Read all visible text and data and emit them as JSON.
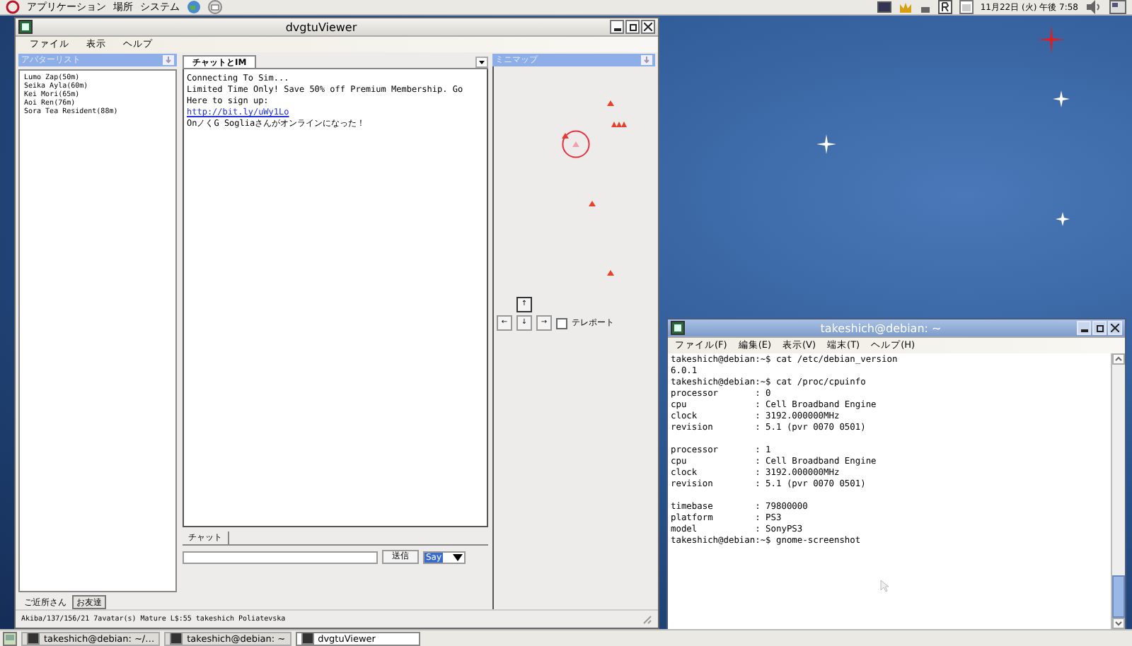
{
  "top_panel": {
    "menus": [
      "アプリケーション",
      "場所",
      "システム"
    ],
    "clock": "11月22日 (火) 午後 7:58"
  },
  "viewer": {
    "title": "dvgtuViewer",
    "menus": [
      "ファイル",
      "表示",
      "ヘルプ"
    ],
    "avatar_list": {
      "title": "アバターリスト",
      "items": [
        "Lumo Zap(50m)",
        "Seika Ayla(60m)",
        "Kei Mori(65m)",
        "Aoi Ren(76m)",
        "Sora Tea Resident(88m)"
      ],
      "tabs": [
        {
          "label": "ご近所さん",
          "selected": true
        },
        {
          "label": "お友達",
          "selected": false
        }
      ]
    },
    "chat": {
      "tabs": [
        {
          "label": "チャットとIM",
          "selected": true
        }
      ],
      "lines": [
        {
          "kind": "text",
          "text": "Connecting To Sim..."
        },
        {
          "kind": "text",
          "text": "Limited Time Only! Save 50% off Premium Membership. Go Here to sign up:"
        },
        {
          "kind": "link",
          "text": "http://bit.ly/uWy1Lo"
        },
        {
          "kind": "text",
          "text": "OnノくG Sogliaさんがオンラインになった！"
        }
      ],
      "input_tabs": [
        {
          "label": "チャット",
          "selected": true
        }
      ],
      "send": "送信",
      "mode": "Say"
    },
    "minimap": {
      "title": "ミニマップ",
      "markers": [
        {
          "kind": "avatar"
        },
        {
          "kind": "group"
        },
        {
          "kind": "avatar"
        },
        {
          "kind": "self"
        },
        {
          "kind": "avatar"
        },
        {
          "kind": "avatar"
        }
      ],
      "controls": {
        "up": "↑",
        "left": "←",
        "down": "↓",
        "right": "→",
        "teleport": {
          "label": "テレポート",
          "checked": false
        }
      }
    },
    "status": "Akiba/137/156/21 7avatar(s) Mature  L$:55  takeshich Poliatevska"
  },
  "terminal": {
    "title": "takeshich@debian: ~",
    "menus": [
      "ファイル(F)",
      "編集(E)",
      "表示(V)",
      "端末(T)",
      "ヘルプ(H)"
    ],
    "blocks": [
      [
        "takeshich@debian:~$ cat /etc/debian_version",
        "6.0.1",
        "takeshich@debian:~$ cat /proc/cpuinfo",
        "processor       : 0",
        "cpu             : Cell Broadband Engine",
        "clock           : 3192.000000MHz",
        "revision        : 5.1 (pvr 0070 0501)"
      ],
      [
        "processor       : 1",
        "cpu             : Cell Broadband Engine",
        "clock           : 3192.000000MHz",
        "revision        : 5.1 (pvr 0070 0501)"
      ],
      [
        "timebase        : 79800000",
        "platform        : PS3",
        "model           : SonyPS3",
        "takeshich@debian:~$ gnome-screenshot"
      ]
    ]
  },
  "taskbar": [
    {
      "label": "takeshich@debian: ~/…",
      "selected": false
    },
    {
      "label": "takeshich@debian: ~",
      "selected": false
    },
    {
      "label": "dvgtuViewer",
      "selected": true
    }
  ]
}
